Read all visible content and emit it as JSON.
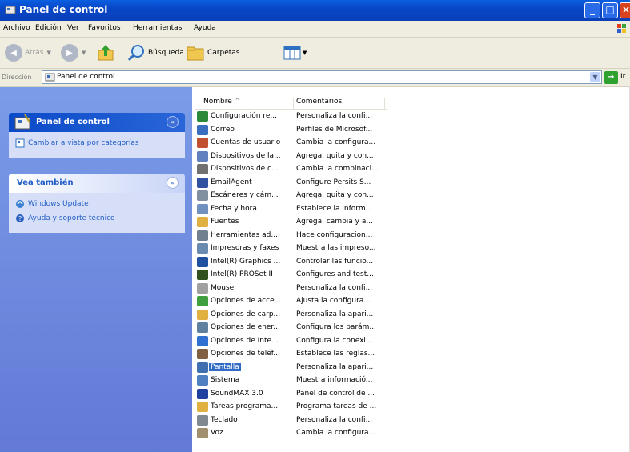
{
  "window": {
    "title": "Panel de control"
  },
  "menu": [
    "Archivo",
    "Edición",
    "Ver",
    "Favoritos",
    "Herramientas",
    "Ayuda"
  ],
  "toolbar": {
    "back": "Atrás",
    "search": "Búsqueda",
    "folders": "Carpetas"
  },
  "address": {
    "label": "Dirección",
    "value": "Panel de control",
    "go_label": "Ir"
  },
  "left_panel": {
    "panel1": {
      "title": "Panel de control",
      "link": "Cambiar a vista por categorías"
    },
    "panel2": {
      "title": "Vea también",
      "links": [
        "Windows Update",
        "Ayuda y soporte técnico"
      ]
    }
  },
  "columns": {
    "name": "Nombre",
    "comments": "Comentarios"
  },
  "items": [
    {
      "name": "Configuración re...",
      "comment": "Personaliza la confi...",
      "color": "#2a8a3a"
    },
    {
      "name": "Correo",
      "comment": "Perfiles de Microsof...",
      "color": "#3a6fc0"
    },
    {
      "name": "Cuentas de usuario",
      "comment": "Cambia la configura...",
      "color": "#c05030"
    },
    {
      "name": "Dispositivos de la...",
      "comment": "Agrega, quita y con...",
      "color": "#6080c0"
    },
    {
      "name": "Dispositivos de c...",
      "comment": "Cambia la combinaci...",
      "color": "#707070"
    },
    {
      "name": "EmailAgent",
      "comment": "Configure Persits S...",
      "color": "#3050a0"
    },
    {
      "name": "Escáneres y cám...",
      "comment": "Agrega, quita y con...",
      "color": "#8090a0"
    },
    {
      "name": "Fecha y hora",
      "comment": "Establece la inform...",
      "color": "#7090c0"
    },
    {
      "name": "Fuentes",
      "comment": "Agrega, cambia y a...",
      "color": "#e0b040"
    },
    {
      "name": "Herramientas ad...",
      "comment": "Hace configuracion...",
      "color": "#708090"
    },
    {
      "name": "Impresoras y faxes",
      "comment": "Muestra las impreso...",
      "color": "#6a8ab0"
    },
    {
      "name": "Intel(R) Graphics ...",
      "comment": "Controlar las funcio...",
      "color": "#2050a0"
    },
    {
      "name": "Intel(R) PROSet II",
      "comment": "Configures and test...",
      "color": "#305020"
    },
    {
      "name": "Mouse",
      "comment": "Personaliza la confi...",
      "color": "#a0a0a0"
    },
    {
      "name": "Opciones de acce...",
      "comment": "Ajusta la configura...",
      "color": "#40a040"
    },
    {
      "name": "Opciones de carp...",
      "comment": "Personaliza la apari...",
      "color": "#e0b040"
    },
    {
      "name": "Opciones de ener...",
      "comment": "Configura los parám...",
      "color": "#6080a0"
    },
    {
      "name": "Opciones de Inte...",
      "comment": "Configura la conexi...",
      "color": "#3070d0"
    },
    {
      "name": "Opciones de teléf...",
      "comment": "Establece las reglas...",
      "color": "#806040"
    },
    {
      "name": "Pantalla",
      "comment": "Personaliza la apari...",
      "color": "#4070b0",
      "selected": true
    },
    {
      "name": "Sistema",
      "comment": "Muestra informació...",
      "color": "#5080c0"
    },
    {
      "name": "SoundMAX 3.0",
      "comment": "Panel de control de ...",
      "color": "#2040a0"
    },
    {
      "name": "Tareas programa...",
      "comment": "Programa tareas de ...",
      "color": "#e0b040"
    },
    {
      "name": "Teclado",
      "comment": "Personaliza la confi...",
      "color": "#808890"
    },
    {
      "name": "Voz",
      "comment": "Cambia la configura...",
      "color": "#a09070"
    }
  ]
}
